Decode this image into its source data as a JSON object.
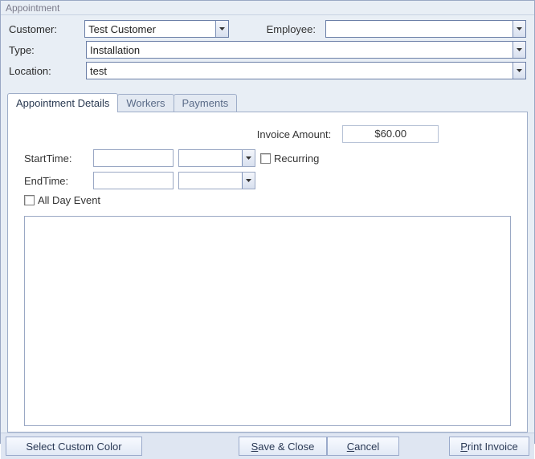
{
  "window": {
    "title": "Appointment"
  },
  "header": {
    "customer_label": "Customer:",
    "customer_value": "Test Customer",
    "employee_label": "Employee:",
    "employee_value": "",
    "type_label": "Type:",
    "type_value": "Installation",
    "location_label": "Location:",
    "location_value": "test"
  },
  "tabs": {
    "details": "Appointment Details",
    "workers": "Workers",
    "payments": "Payments"
  },
  "details": {
    "invoice_label": "Invoice Amount:",
    "invoice_value": "$60.00",
    "start_label": "StartTime:",
    "start_date": "",
    "start_time": "",
    "end_label": "EndTime:",
    "end_date": "",
    "end_time": "",
    "recurring_label": "Recurring",
    "allday_label": "All Day Event",
    "notes": ""
  },
  "footer": {
    "color": "Select Custom Color",
    "save": "Save & Close",
    "cancel": "Cancel",
    "print": "Print Invoice"
  }
}
